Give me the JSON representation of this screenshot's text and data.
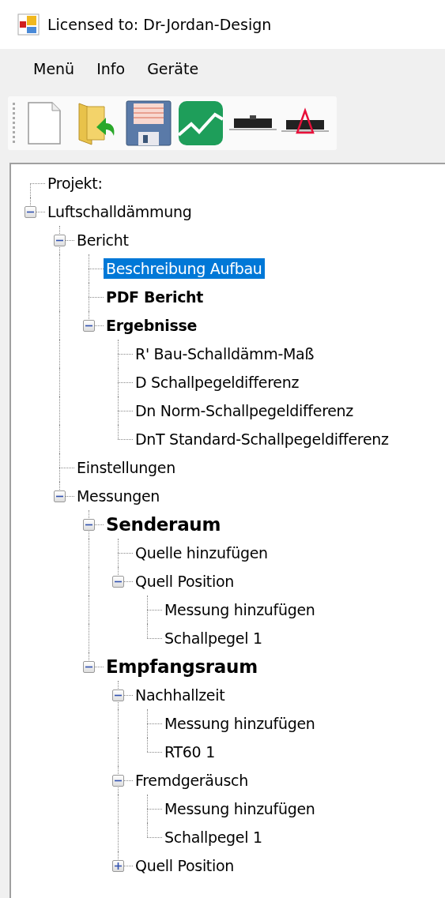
{
  "window": {
    "title": "Licensed to: Dr-Jordan-Design"
  },
  "menu": [
    "Menü",
    "Info",
    "Geräte"
  ],
  "toolbar": [
    {
      "kind": "new"
    },
    {
      "kind": "open"
    },
    {
      "kind": "save"
    },
    {
      "kind": "chart"
    },
    {
      "kind": "device"
    },
    {
      "kind": "device-alert"
    }
  ],
  "tree": [
    {
      "text": "Projekt:",
      "kind": "normal",
      "selected": false
    },
    {
      "text": "Luftschalldämmung",
      "kind": "normal",
      "selected": false,
      "expanded": true,
      "children": [
        {
          "text": "Bericht",
          "kind": "normal",
          "selected": false,
          "expanded": true,
          "children": [
            {
              "text": "Beschreibung Aufbau",
              "kind": "normal",
              "selected": true
            },
            {
              "text": "PDF Bericht",
              "kind": "bold",
              "selected": false
            },
            {
              "text": "Ergebnisse",
              "kind": "bold",
              "selected": false,
              "expanded": true,
              "children": [
                {
                  "text": "R' Bau-Schalldämm-Maß",
                  "kind": "normal",
                  "selected": false
                },
                {
                  "text": "D Schallpegeldifferenz",
                  "kind": "normal",
                  "selected": false
                },
                {
                  "text": "Dn Norm-Schallpegeldifferenz",
                  "kind": "normal",
                  "selected": false
                },
                {
                  "text": "DnT Standard-Schallpegeldifferenz",
                  "kind": "normal",
                  "selected": false
                }
              ]
            }
          ]
        },
        {
          "text": "Einstellungen",
          "kind": "normal",
          "selected": false
        },
        {
          "text": "Messungen",
          "kind": "normal",
          "selected": false,
          "expanded": true,
          "children": [
            {
              "text": "Senderaum",
              "kind": "heading",
              "selected": false,
              "expanded": true,
              "children": [
                {
                  "text": "Quelle hinzufügen",
                  "kind": "normal",
                  "selected": false
                },
                {
                  "text": "Quell Position",
                  "kind": "normal",
                  "selected": false,
                  "expanded": true,
                  "children": [
                    {
                      "text": "Messung hinzufügen",
                      "kind": "normal",
                      "selected": false
                    },
                    {
                      "text": "Schallpegel 1",
                      "kind": "normal",
                      "selected": false
                    }
                  ]
                }
              ]
            },
            {
              "text": "Empfangsraum",
              "kind": "heading",
              "selected": false,
              "expanded": true,
              "children": [
                {
                  "text": "Nachhallzeit",
                  "kind": "normal",
                  "selected": false,
                  "expanded": true,
                  "children": [
                    {
                      "text": "Messung hinzufügen",
                      "kind": "normal",
                      "selected": false
                    },
                    {
                      "text": "RT60 1",
                      "kind": "normal",
                      "selected": false
                    }
                  ]
                },
                {
                  "text": "Fremdgeräusch",
                  "kind": "normal",
                  "selected": false,
                  "expanded": true,
                  "children": [
                    {
                      "text": "Messung hinzufügen",
                      "kind": "normal",
                      "selected": false
                    },
                    {
                      "text": "Schallpegel 1",
                      "kind": "normal",
                      "selected": false
                    }
                  ]
                },
                {
                  "text": "Quell Position",
                  "kind": "normal",
                  "selected": false,
                  "expanded": false
                }
              ]
            }
          ]
        }
      ]
    }
  ]
}
